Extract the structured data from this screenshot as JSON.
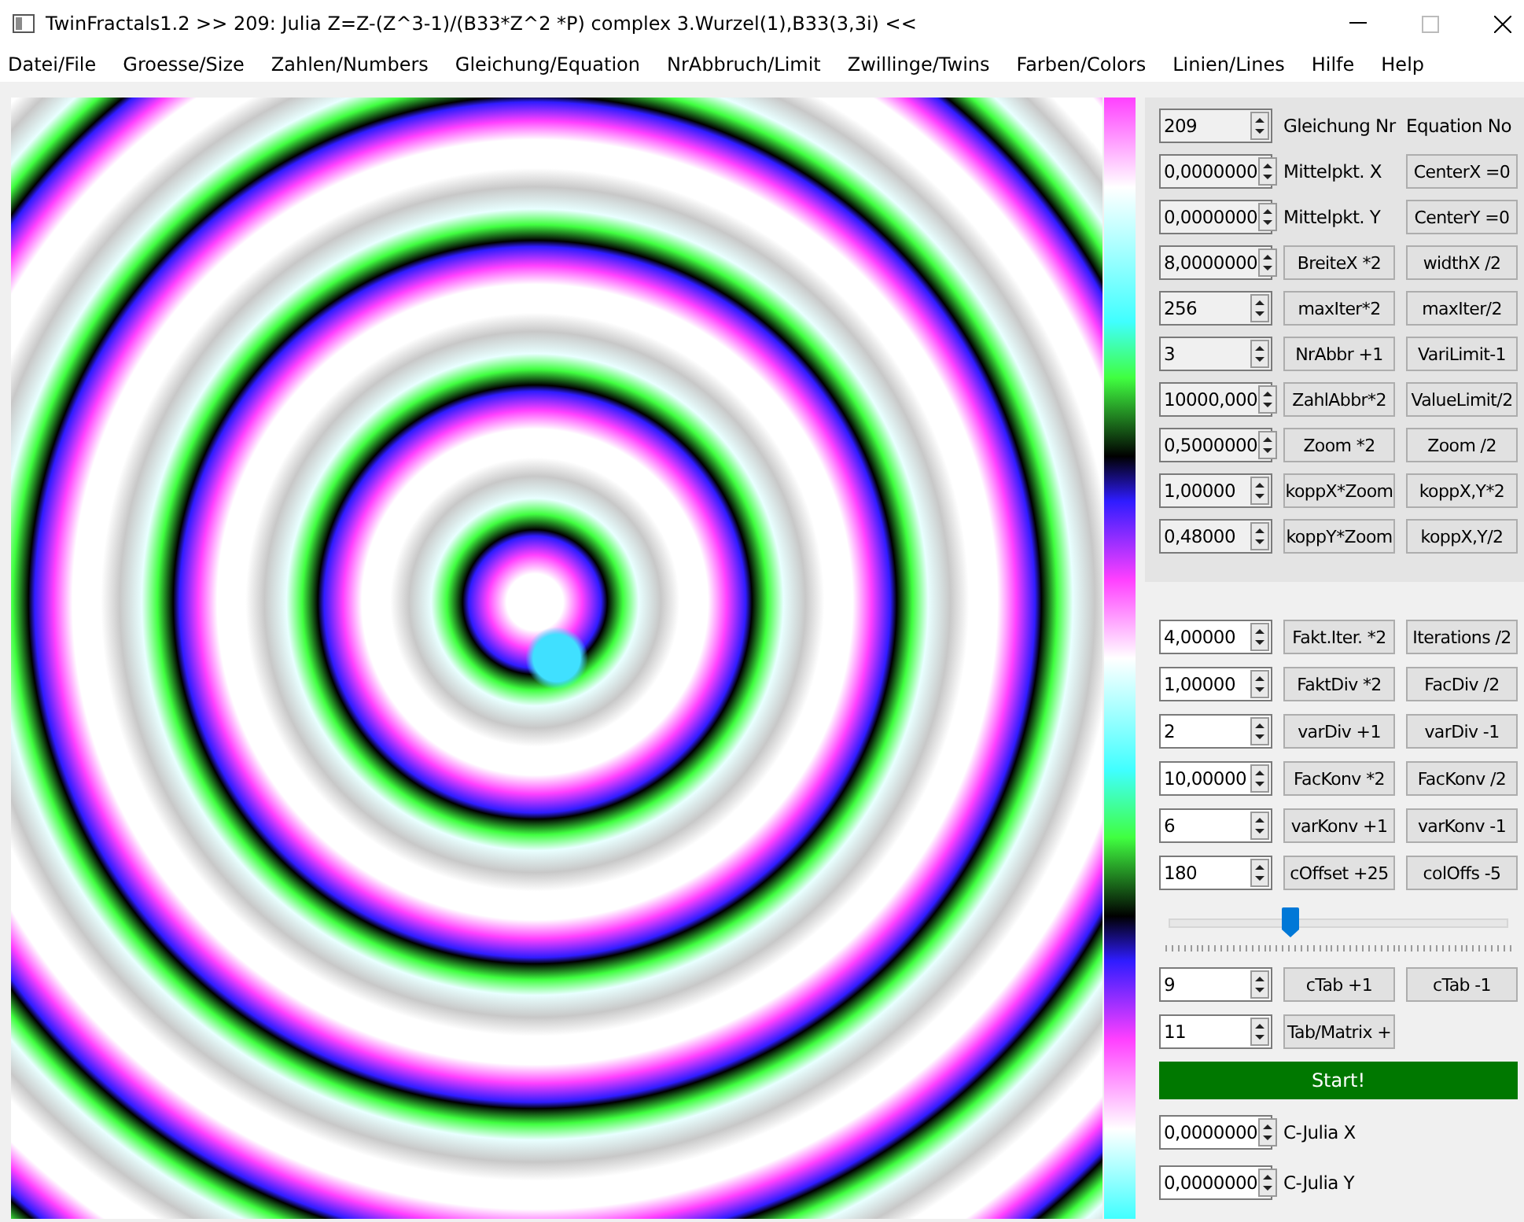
{
  "window": {
    "title": "TwinFractals1.2 >> 209: Julia Z=Z-(Z^3-1)/(B33*Z^2 *P) complex 3.Wurzel(1),B33(3,3i) <<"
  },
  "menu": [
    "Datei/File",
    "Groesse/Size",
    "Zahlen/Numbers",
    "Gleichung/Equation",
    "NrAbbruch/Limit",
    "Zwillinge/Twins",
    "Farben/Colors",
    "Linien/Lines",
    "Hilfe",
    "Help"
  ],
  "upper_rows": [
    {
      "value": "209",
      "disabled": true,
      "cells": [
        {
          "kind": "label",
          "text": "Gleichung Nr"
        },
        {
          "kind": "label",
          "text": "Equation No"
        }
      ]
    },
    {
      "value": "0,0000000",
      "disabled": true,
      "cells": [
        {
          "kind": "label",
          "text": "Mittelpkt. X"
        },
        {
          "kind": "button",
          "text": "CenterX =0"
        }
      ]
    },
    {
      "value": "0,0000000",
      "disabled": true,
      "cells": [
        {
          "kind": "label",
          "text": "Mittelpkt. Y"
        },
        {
          "kind": "button",
          "text": "CenterY =0"
        }
      ]
    },
    {
      "value": "8,0000000",
      "disabled": true,
      "cells": [
        {
          "kind": "button",
          "text": "BreiteX *2"
        },
        {
          "kind": "button",
          "text": "widthX /2"
        }
      ]
    },
    {
      "value": "256",
      "disabled": true,
      "cells": [
        {
          "kind": "button",
          "text": "maxIter*2"
        },
        {
          "kind": "button",
          "text": "maxIter/2"
        }
      ]
    },
    {
      "value": "3",
      "disabled": true,
      "cells": [
        {
          "kind": "button",
          "text": "NrAbbr +1"
        },
        {
          "kind": "button",
          "text": "VariLimit-1"
        }
      ]
    },
    {
      "value": "10000,000",
      "disabled": true,
      "cells": [
        {
          "kind": "button",
          "text": "ZahlAbbr*2"
        },
        {
          "kind": "button",
          "text": "ValueLimit/2"
        }
      ]
    },
    {
      "value": "0,5000000",
      "disabled": true,
      "cells": [
        {
          "kind": "button",
          "text": "Zoom *2"
        },
        {
          "kind": "button",
          "text": "Zoom /2"
        }
      ]
    },
    {
      "value": "1,00000",
      "disabled": true,
      "cells": [
        {
          "kind": "button",
          "text": "koppX*Zoom"
        },
        {
          "kind": "button",
          "text": "koppX,Y*2"
        }
      ]
    },
    {
      "value": "0,48000",
      "disabled": true,
      "cells": [
        {
          "kind": "button",
          "text": "koppY*Zoom"
        },
        {
          "kind": "button",
          "text": "koppX,Y/2"
        }
      ]
    }
  ],
  "lower_rows": [
    {
      "value": "4,00000",
      "disabled": false,
      "cells": [
        {
          "kind": "button",
          "text": "Fakt.Iter. *2"
        },
        {
          "kind": "button",
          "text": "Iterations /2"
        }
      ]
    },
    {
      "value": "1,00000",
      "disabled": false,
      "cells": [
        {
          "kind": "button",
          "text": "FaktDiv *2"
        },
        {
          "kind": "button",
          "text": "FacDiv /2"
        }
      ]
    },
    {
      "value": "2",
      "disabled": false,
      "cells": [
        {
          "kind": "button",
          "text": "varDiv +1"
        },
        {
          "kind": "button",
          "text": "varDiv -1"
        }
      ]
    },
    {
      "value": "10,00000",
      "disabled": false,
      "cells": [
        {
          "kind": "button",
          "text": "FacKonv *2"
        },
        {
          "kind": "button",
          "text": "FacKonv /2"
        }
      ]
    },
    {
      "value": "6",
      "disabled": false,
      "cells": [
        {
          "kind": "button",
          "text": "varKonv +1"
        },
        {
          "kind": "button",
          "text": "varKonv -1"
        }
      ]
    },
    {
      "value": "180",
      "disabled": false,
      "cells": [
        {
          "kind": "button",
          "text": "cOffset +25"
        },
        {
          "kind": "button",
          "text": "colOffs -5"
        }
      ]
    }
  ],
  "slider": {
    "level": 0.36
  },
  "color_rows": [
    {
      "value": "9",
      "disabled": false,
      "cells": [
        {
          "kind": "button",
          "text": "cTab +1"
        },
        {
          "kind": "button",
          "text": "cTab -1"
        }
      ]
    },
    {
      "value": "11",
      "disabled": false,
      "cells": [
        {
          "kind": "button",
          "text": "Tab/Matrix +"
        }
      ]
    }
  ],
  "start_button": "Start!",
  "julia_rows": [
    {
      "value": "0,0000000",
      "disabled": false,
      "cells": [
        {
          "kind": "label",
          "text": "C-Julia X"
        }
      ]
    },
    {
      "value": "0,0000000",
      "disabled": false,
      "cells": [
        {
          "kind": "label",
          "text": "C-Julia Y"
        }
      ]
    }
  ]
}
